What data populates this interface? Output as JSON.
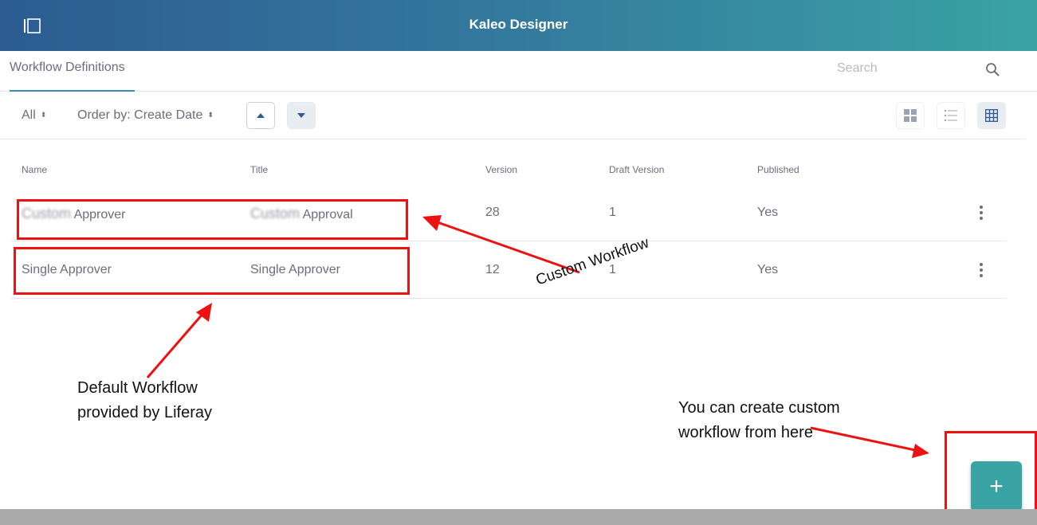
{
  "header": {
    "title": "Kaleo Designer",
    "toggle_icon": "sidebar-toggle-icon"
  },
  "nav": {
    "tab_label": "Workflow Definitions",
    "search_placeholder": "Search"
  },
  "toolbar": {
    "filter_label": "All",
    "order_label": "Order by: Create Date"
  },
  "table": {
    "headers": {
      "name": "Name",
      "title": "Title",
      "version": "Version",
      "draft_version": "Draft Version",
      "published": "Published"
    },
    "rows": [
      {
        "name_blurred": "Custom",
        "name_rest": "Approver",
        "title_blurred": "Custom",
        "title_rest": "Approval",
        "version": "28",
        "draft_version": "1",
        "published": "Yes"
      },
      {
        "name": "Single Approver",
        "title": "Single Approver",
        "version": "12",
        "draft_version": "1",
        "published": "Yes"
      }
    ]
  },
  "annotations": {
    "custom_workflow": "Custom Workflow",
    "default_line1": "Default Workflow",
    "default_line2": "provided by Liferay",
    "create_line1": "You can create custom",
    "create_line2": "workflow from here",
    "color": "#ee1111"
  },
  "fab": {
    "label": "+"
  },
  "colors": {
    "header_start": "#2c5c92",
    "header_end": "#3aa3a4",
    "accent": "#3aa3a4"
  }
}
